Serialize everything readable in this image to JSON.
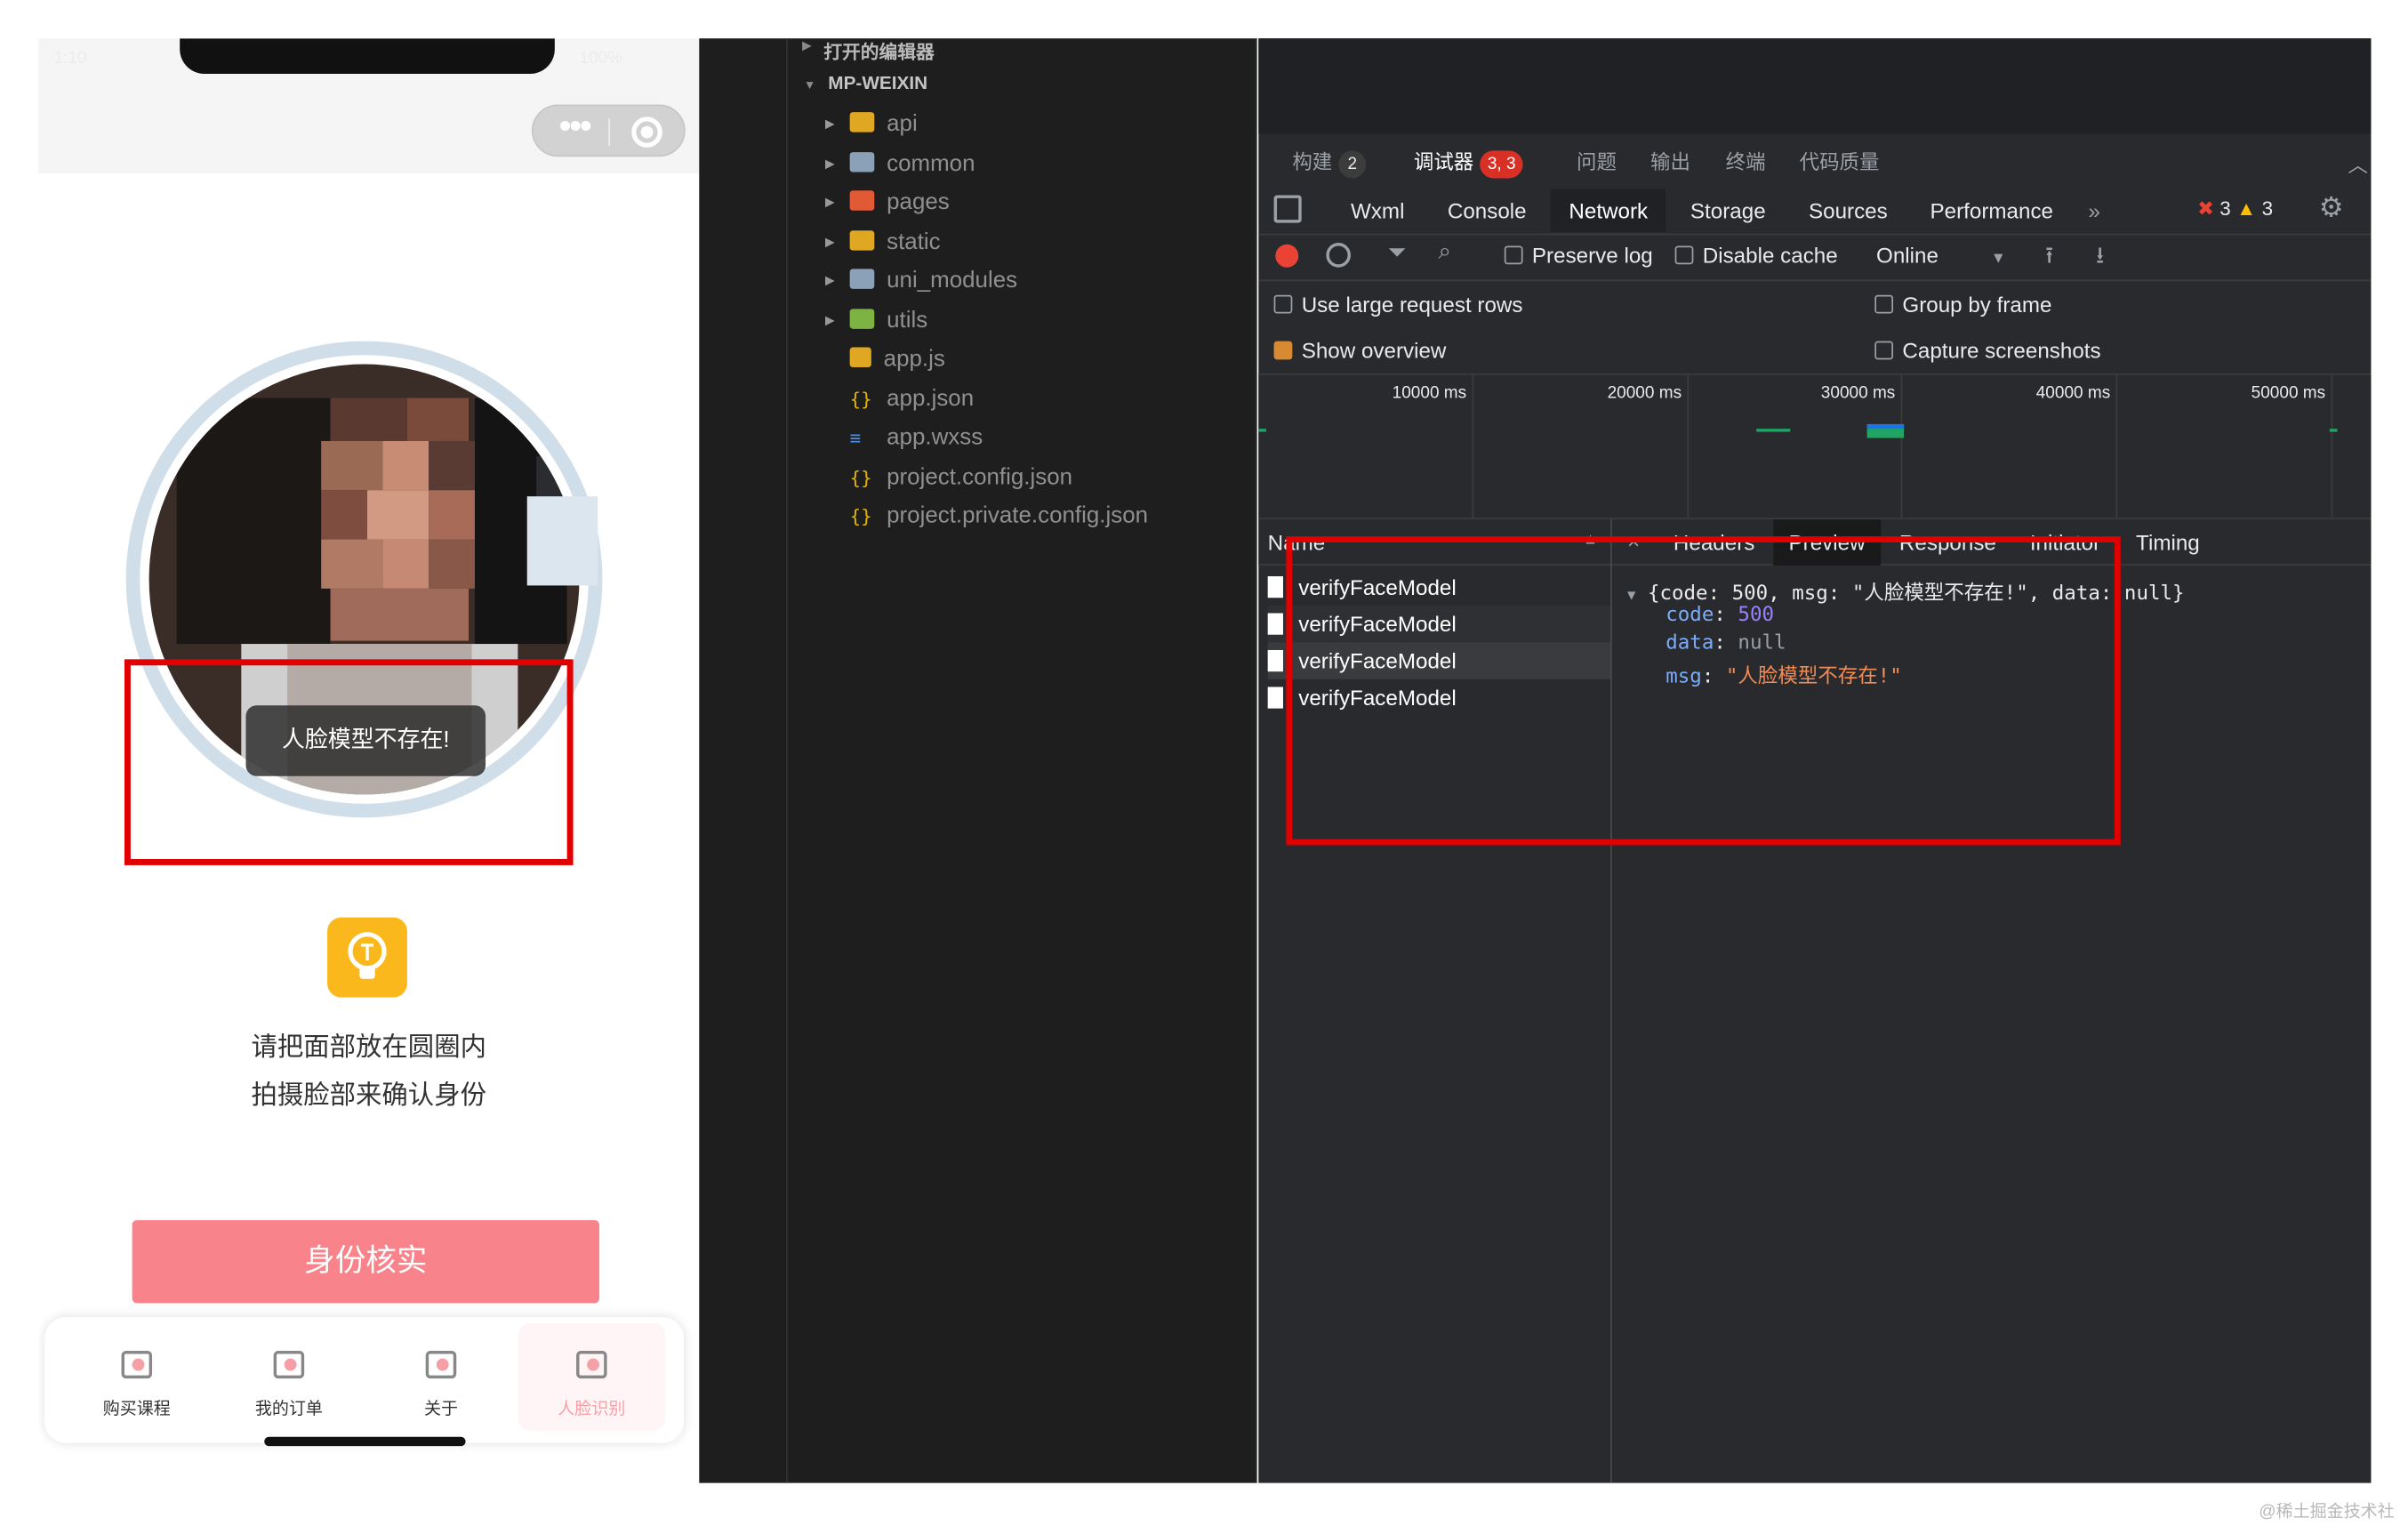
{
  "phone": {
    "status_time": "1:10",
    "status_battery": "100%",
    "toast": "人脸模型不存在!",
    "hint_line1": "请把面部放在圆圈内",
    "hint_line2": "拍摄脸部来确认身份",
    "verify_button": "身份核实",
    "tabs": [
      {
        "label": "购买课程",
        "icon": "course-icon"
      },
      {
        "label": "我的订单",
        "icon": "cart-icon"
      },
      {
        "label": "关于",
        "icon": "about-icon"
      },
      {
        "label": "人脸识别",
        "icon": "face-icon",
        "active": true
      }
    ]
  },
  "explorer": {
    "open_editors": "打开的编辑器",
    "root": "MP-WEIXIN",
    "folders": [
      {
        "name": "api",
        "icon": "folder-api-icon",
        "color": "#e0a722"
      },
      {
        "name": "common",
        "icon": "folder-icon",
        "color": "#8aa1b7"
      },
      {
        "name": "pages",
        "icon": "folder-pages-icon",
        "color": "#e25a35"
      },
      {
        "name": "static",
        "icon": "folder-static-icon",
        "color": "#e0a722"
      },
      {
        "name": "uni_modules",
        "icon": "folder-icon",
        "color": "#8aa1b7"
      },
      {
        "name": "utils",
        "icon": "folder-utils-icon",
        "color": "#7cb342"
      }
    ],
    "files": [
      {
        "name": "app.js",
        "icon": "js-file-icon"
      },
      {
        "name": "app.json",
        "icon": "json-file-icon"
      },
      {
        "name": "app.wxss",
        "icon": "css-file-icon"
      },
      {
        "name": "project.config.json",
        "icon": "json-file-icon"
      },
      {
        "name": "project.private.config.json",
        "icon": "json-file-icon"
      }
    ]
  },
  "devtools": {
    "top_tabs": {
      "build": "构建",
      "build_badge": "2",
      "debugger": "调试器",
      "debugger_badge": "3, 3",
      "issues": "问题",
      "output": "输出",
      "terminal": "终端",
      "quality": "代码质量"
    },
    "panels": [
      "Wxml",
      "Console",
      "Network",
      "Storage",
      "Sources",
      "Performance"
    ],
    "active_panel": "Network",
    "more_panels": "»",
    "error_count": "3",
    "warning_count": "3",
    "toolbar": {
      "preserve_log": "Preserve log",
      "disable_cache": "Disable cache",
      "throttle": "Online"
    },
    "options": {
      "large_rows": "Use large request rows",
      "group_by_frame": "Group by frame",
      "show_overview": "Show overview",
      "capture_screenshots": "Capture screenshots"
    },
    "timeline_ticks": [
      "10000 ms",
      "20000 ms",
      "30000 ms",
      "40000 ms",
      "50000 ms"
    ],
    "requests_header": "Name",
    "requests": [
      "verifyFaceModel",
      "verifyFaceModel",
      "verifyFaceModel",
      "verifyFaceModel"
    ],
    "detail_tabs": [
      "Headers",
      "Preview",
      "Response",
      "Initiator",
      "Timing"
    ],
    "active_detail_tab": "Preview",
    "preview": {
      "summary": "{code: 500, msg: \"人脸模型不存在!\", data: null}",
      "code_key": "code",
      "code_val": "500",
      "data_key": "data",
      "data_val": "null",
      "msg_key": "msg",
      "msg_val": "\"人脸模型不存在!\""
    }
  },
  "watermark": "@稀土掘金技术社区",
  "colors": {
    "accent_pink": "#f8838a",
    "highlight_red": "#e00000",
    "devtools_bg": "#292a2d"
  }
}
